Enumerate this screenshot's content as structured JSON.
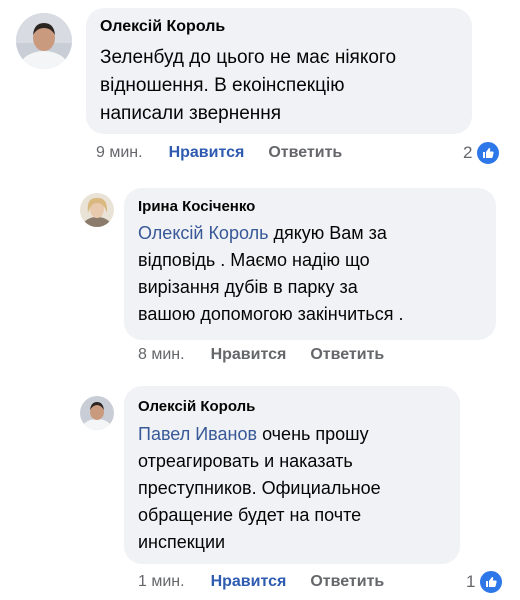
{
  "comments": [
    {
      "author": "Олексій Король",
      "text_lines": [
        "Зеленбуд до цього не має ніякого",
        "відношення. В екоінспекцію",
        "написали звернення"
      ],
      "time": "9 мин.",
      "like_label": "Нравится",
      "reply_label": "Ответить",
      "reaction_count": "2"
    },
    {
      "author": "Ірина Косіченко",
      "mention": "Олексій Король",
      "text_first_rest": " дякую Вам за",
      "text_lines": [
        "відповідь . Маємо надію що",
        "вирізання дубів в парку за",
        "вашою допомогою закінчиться ."
      ],
      "time": "8 мин.",
      "like_label": "Нравится",
      "reply_label": "Ответить"
    },
    {
      "author": "Олексій Король",
      "mention": "Павел Иванов",
      "text_first_rest": " очень прошу",
      "text_lines": [
        "отреагировать и наказать",
        "преступников. Официальное",
        "обращение будет на почте",
        "инспекции"
      ],
      "time": "1 мин.",
      "like_label": "Нравится",
      "reply_label": "Ответить",
      "reaction_count": "1"
    }
  ],
  "colors": {
    "bubble": "#f0f2f5",
    "mention": "#385898",
    "like_active": "#2e5bb0",
    "reaction_badge": "#2e77e8",
    "meta_text": "#65676b"
  },
  "icons": {
    "reaction": "thumbs-up-icon"
  }
}
